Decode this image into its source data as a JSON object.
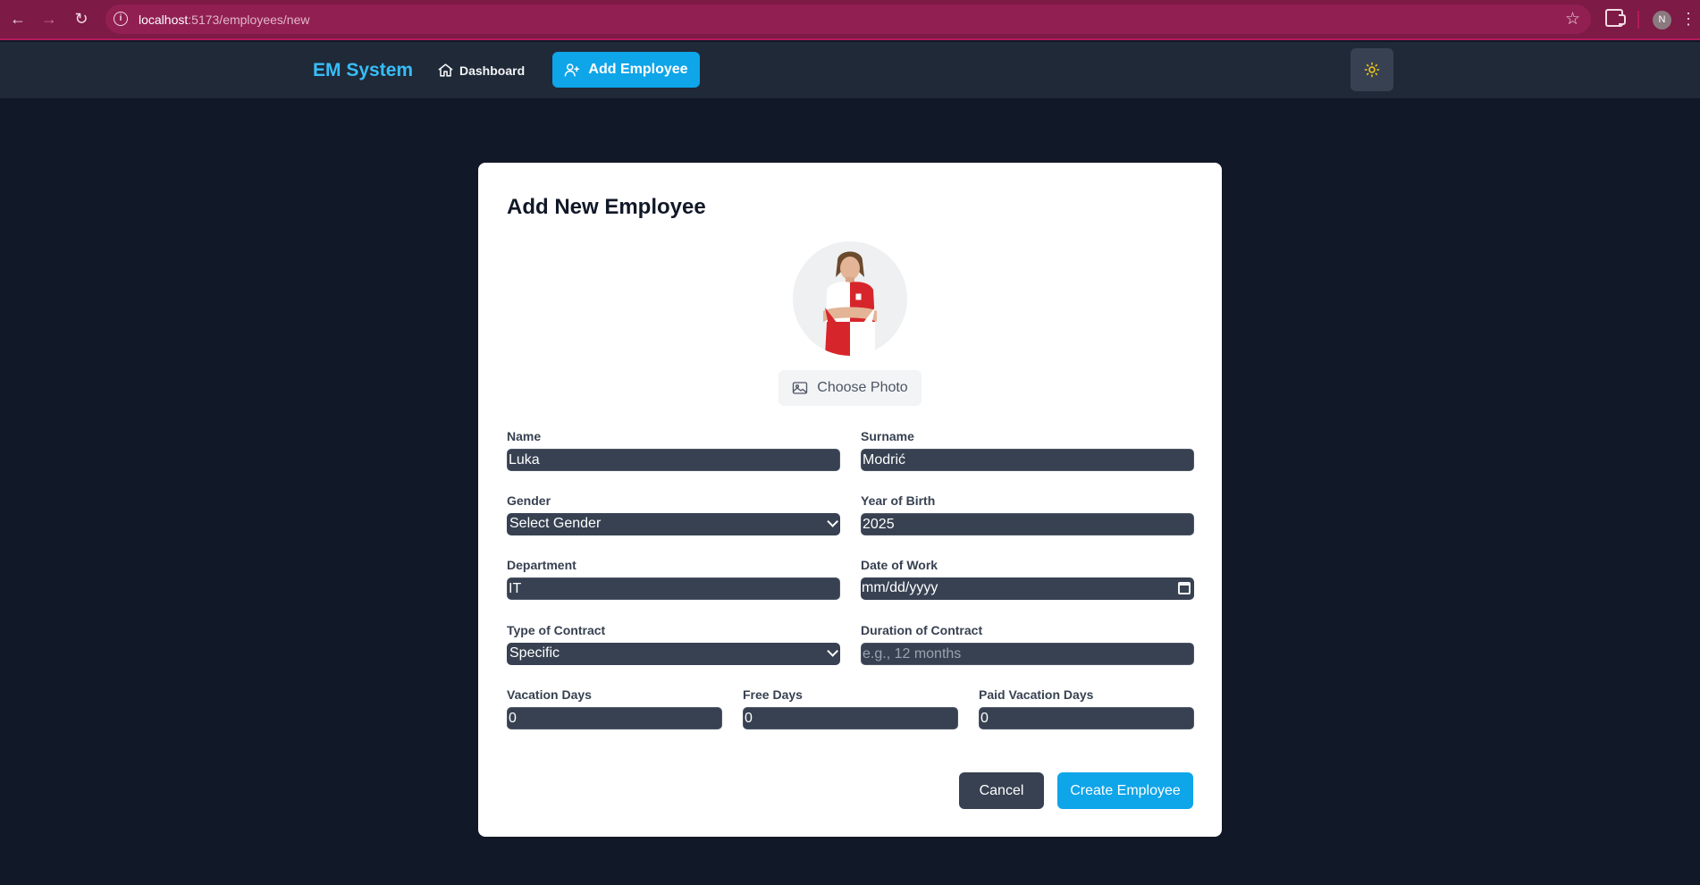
{
  "browser": {
    "url_host": "localhost",
    "url_path": ":5173/employees/new",
    "profile_initial": "N"
  },
  "header": {
    "brand": "EM System",
    "nav": {
      "dashboard": "Dashboard",
      "add_employee": "Add Employee"
    }
  },
  "form": {
    "title": "Add New Employee",
    "choose_photo": "Choose Photo",
    "fields": {
      "name": {
        "label": "Name",
        "value": "Luka"
      },
      "surname": {
        "label": "Surname",
        "value": "Modrić"
      },
      "gender": {
        "label": "Gender",
        "value": "Select Gender"
      },
      "year_of_birth": {
        "label": "Year of Birth",
        "value": "2025"
      },
      "department": {
        "label": "Department",
        "value": "IT"
      },
      "date_of_work": {
        "label": "Date of Work",
        "value": "mm/dd/yyyy"
      },
      "type_of_contract": {
        "label": "Type of Contract",
        "value": "Specific"
      },
      "duration_of_contract": {
        "label": "Duration of Contract",
        "value": "",
        "placeholder": "e.g., 12 months"
      },
      "vacation_days": {
        "label": "Vacation Days",
        "value": "0"
      },
      "free_days": {
        "label": "Free Days",
        "value": "0"
      },
      "paid_vacation_days": {
        "label": "Paid Vacation Days",
        "value": "0"
      }
    },
    "buttons": {
      "cancel": "Cancel",
      "create": "Create Employee"
    }
  }
}
